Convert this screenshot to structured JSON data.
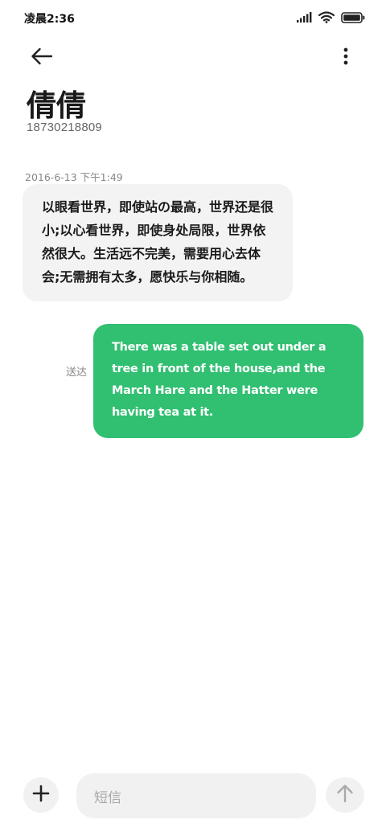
{
  "status_bar": {
    "time": "凌晨2:36",
    "icons": [
      "signal-icon",
      "wifi-icon",
      "battery-icon"
    ]
  },
  "header": {
    "back_icon": "arrow-left-icon",
    "more_icon": "more-vertical-icon"
  },
  "contact": {
    "name": "倩倩",
    "number": "18730218809"
  },
  "conversation": {
    "timestamp": "2016-6-13 下午1:49",
    "incoming_message": "以眼看世界，即使站の最高，世界还是很小;以心看世界，即使身处局限，世界依然很大。生活远不完美，需要用心去体会;无需拥有太多，愿快乐与你相随。",
    "outgoing_message": "There was a table set out under a tree in front of the house,and the March Hare and the Hatter were having tea at it.",
    "outgoing_status": "送达"
  },
  "composer": {
    "add_icon": "plus-icon",
    "placeholder": "短信",
    "send_icon": "arrow-up-icon"
  },
  "colors": {
    "outgoing_bubble": "#31bf71",
    "incoming_bubble": "#f3f3f3",
    "composer_bg": "#f1f1f1"
  }
}
